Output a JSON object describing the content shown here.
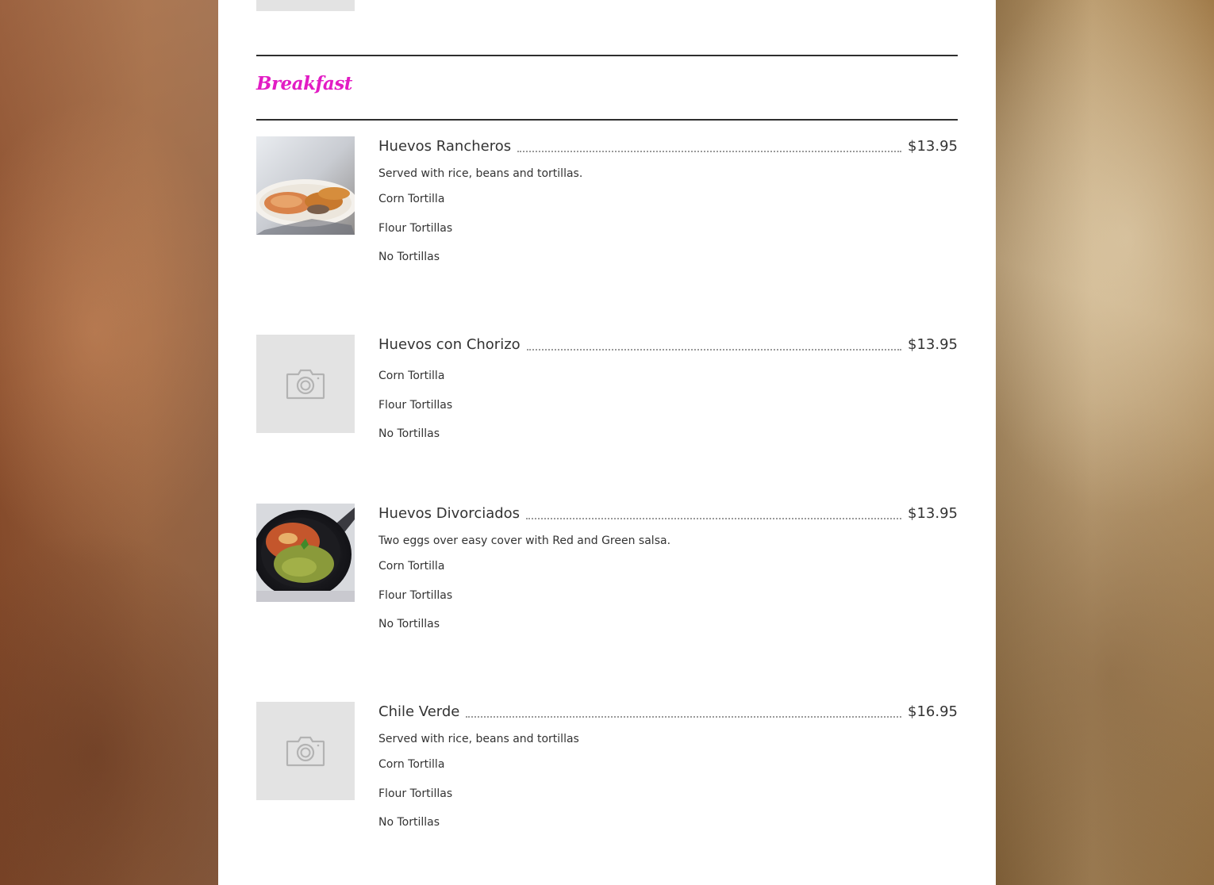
{
  "menu": {
    "section": {
      "title": "Breakfast"
    },
    "items": [
      {
        "name": "Huevos Rancheros",
        "price": "$13.95",
        "description": "Served with rice, beans and tortillas.",
        "options": [
          "Corn Tortilla",
          "Flour Tortillas",
          "No Tortillas"
        ],
        "image": "huevos-rancheros-photo"
      },
      {
        "name": "Huevos con Chorizo",
        "price": "$13.95",
        "description": "",
        "options": [
          "Corn Tortilla",
          "Flour Tortillas",
          "No Tortillas"
        ],
        "image": "camera-placeholder-icon"
      },
      {
        "name": "Huevos Divorciados",
        "price": "$13.95",
        "description": "Two eggs over easy cover with Red and Green salsa.",
        "options": [
          "Corn Tortilla",
          "Flour Tortillas",
          "No Tortillas"
        ],
        "image": "huevos-divorciados-photo"
      },
      {
        "name": "Chile Verde",
        "price": "$16.95",
        "description": "Served with rice, beans and tortillas",
        "options": [
          "Corn Tortilla",
          "Flour Tortillas",
          "No Tortillas"
        ],
        "image": "camera-placeholder-icon"
      }
    ]
  },
  "colors": {
    "section_title": "#e21cc4",
    "text": "#333333",
    "placeholder": "#e3e3e3",
    "rule": "#2e2e2e"
  }
}
